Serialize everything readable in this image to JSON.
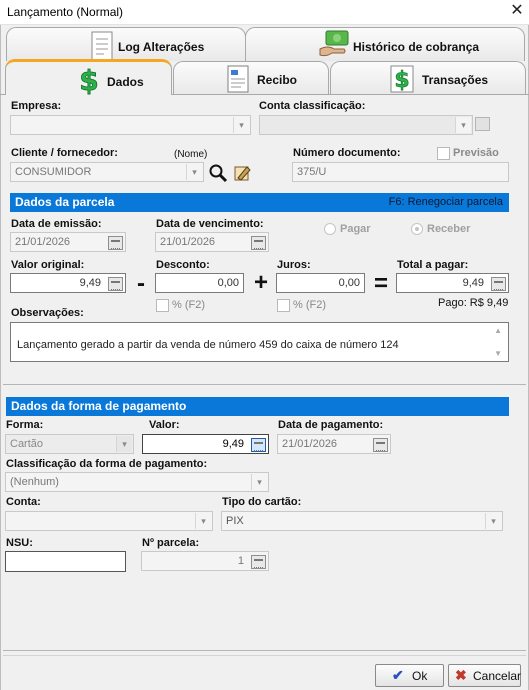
{
  "window": {
    "title": "Lançamento (Normal)",
    "close_glyph": "✕"
  },
  "tabs": {
    "row1": [
      {
        "label": "Log Alterações",
        "icon": "document-log-icon"
      },
      {
        "label": "Histórico de cobrança",
        "icon": "money-hand-icon"
      }
    ],
    "row2": [
      {
        "label": "Dados",
        "icon": "dollar-icon",
        "selected": true
      },
      {
        "label": "Recibo",
        "icon": "receipt-icon"
      },
      {
        "label": "Transações",
        "icon": "dollar-icon"
      }
    ]
  },
  "header": {
    "empresa_label": "Empresa:",
    "empresa_value": "",
    "conta_class_label": "Conta classificação:",
    "conta_class_value": "",
    "cliente_label": "Cliente / fornecedor:",
    "cliente_hint": "(Nome)",
    "cliente_value": "CONSUMIDOR",
    "numero_doc_label": "Número documento:",
    "numero_doc_value": "375/U",
    "previsao_label": "Previsão"
  },
  "parcela": {
    "section_title": "Dados da parcela",
    "shortcut_hint": "F6: Renegociar parcela",
    "emissao_label": "Data de emissão:",
    "emissao_value": "21/01/2026",
    "vencimento_label": "Data de vencimento:",
    "vencimento_value": "21/01/2026",
    "pagar_label": "Pagar",
    "receber_label": "Receber",
    "valor_original_label": "Valor original:",
    "valor_original_value": "9,49",
    "desconto_label": "Desconto:",
    "desconto_value": "0,00",
    "juros_label": "Juros:",
    "juros_value": "0,00",
    "total_label": "Total a pagar:",
    "total_value": "9,49",
    "percent_label": "% (F2)",
    "pago_text": "Pago: R$ 9,49",
    "op_minus": "-",
    "op_plus": "+",
    "op_equals": "=",
    "observacoes_label": "Observações:",
    "observacoes_value": "Lançamento gerado a partir da venda de número 459 do caixa de número 124"
  },
  "pagamento": {
    "section_title": "Dados da forma de pagamento",
    "forma_label": "Forma:",
    "forma_value": "Cartão",
    "valor_label": "Valor:",
    "valor_value": "9,49",
    "data_pag_label": "Data de pagamento:",
    "data_pag_value": "21/01/2026",
    "classificacao_label": "Classificação da forma de pagamento:",
    "classificacao_value": "(Nenhum)",
    "conta_label": "Conta:",
    "conta_value": "",
    "tipo_cartao_label": "Tipo do cartão:",
    "tipo_cartao_value": "PIX",
    "nsu_label": "NSU:",
    "nsu_value": "",
    "parcela_label": "Nº parcela:",
    "parcela_value": "1"
  },
  "footer": {
    "ok_label": "Ok",
    "cancel_label": "Cancelar",
    "ok_glyph": "✔",
    "cancel_glyph": "✖"
  },
  "colors": {
    "section_bar": "#0a78d8",
    "tab_accent": "#f5a623",
    "dollar_green": "#2bb34a",
    "ok_check": "#2a4fbf",
    "cancel_x": "#c0392b"
  }
}
